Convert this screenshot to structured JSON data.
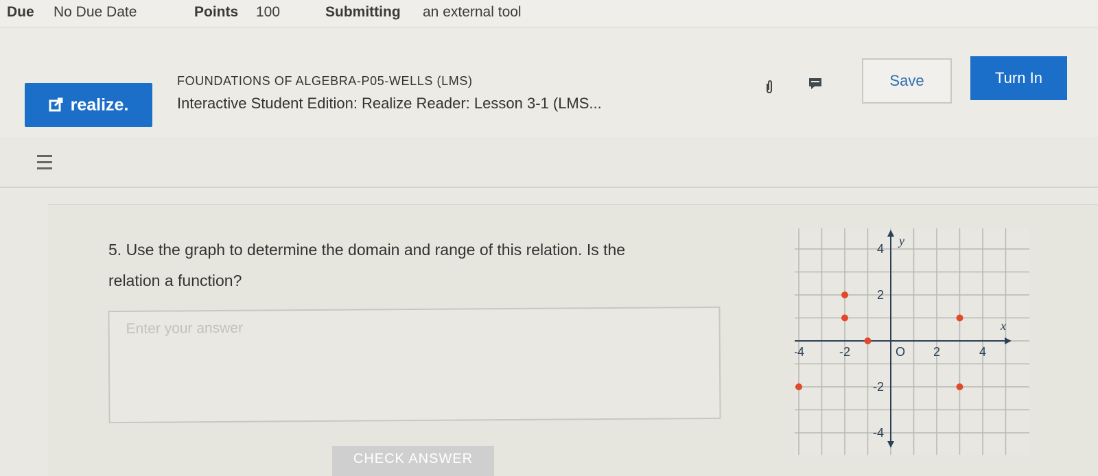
{
  "meta": {
    "due_label": "Due",
    "due_value": "No Due Date",
    "points_label": "Points",
    "points_value": "100",
    "submitting_label": "Submitting",
    "submitting_value": "an external tool"
  },
  "header": {
    "app_logo_text": "realize.",
    "course_title": "FOUNDATIONS OF ALGEBRA-P05-WELLS (LMS)",
    "lesson_title": "Interactive Student Edition: Realize Reader: Lesson 3-1 (LMS...",
    "save_label": "Save",
    "turn_in_label": "Turn In"
  },
  "icons": {
    "attach": "paperclip-icon",
    "comment": "comment-icon",
    "menu": "hamburger-menu-icon",
    "external": "external-link-icon"
  },
  "colors": {
    "brand_blue": "#1b6fc9",
    "point_red": "#e2492a",
    "grid": "#b7b9b4"
  },
  "question": {
    "text": "5. Use the graph to determine the domain and range of this relation. Is the relation a function?",
    "answer_placeholder": "Enter your answer",
    "answer_value": "",
    "check_label": "CHECK ANSWER"
  },
  "chart_data": {
    "type": "scatter",
    "title": "",
    "xlabel": "x",
    "ylabel": "y",
    "xlim": [
      -5,
      5
    ],
    "ylim": [
      -5,
      5
    ],
    "grid": true,
    "x_ticks": [
      "-4",
      "-2",
      "O",
      "2",
      "4"
    ],
    "y_ticks": [
      "4",
      "2",
      "-2",
      "-4"
    ],
    "points": [
      {
        "x": -2,
        "y": 2
      },
      {
        "x": -2,
        "y": 1
      },
      {
        "x": -1,
        "y": 0
      },
      {
        "x": 3,
        "y": 1
      },
      {
        "x": -4,
        "y": -2
      },
      {
        "x": 3,
        "y": -2
      }
    ]
  }
}
